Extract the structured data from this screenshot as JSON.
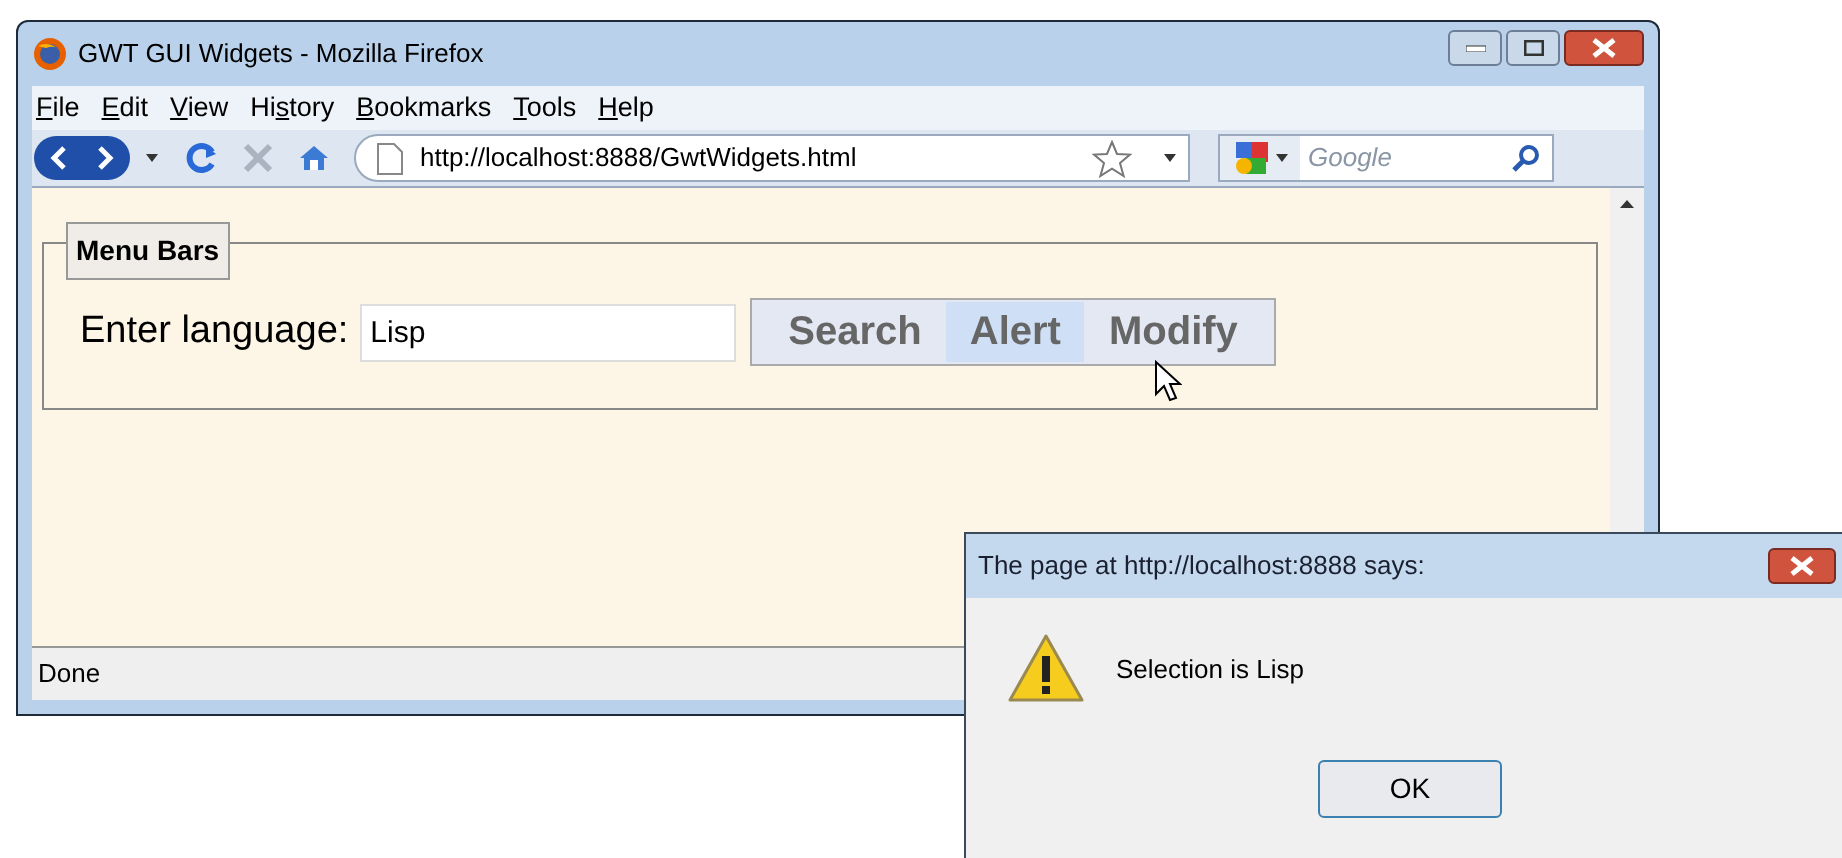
{
  "browser": {
    "title": "GWT GUI Widgets - Mozilla Firefox",
    "menu": [
      {
        "key": "F",
        "after": "ile"
      },
      {
        "key": "E",
        "after": "dit"
      },
      {
        "key": "V",
        "after": "iew"
      },
      {
        "before": "Hi",
        "key": "s",
        "after": "tory"
      },
      {
        "key": "B",
        "after": "ookmarks"
      },
      {
        "key": "T",
        "after": "ools"
      },
      {
        "key": "H",
        "after": "elp"
      }
    ],
    "url": "http://localhost:8888/GwtWidgets.html",
    "search_placeholder": "Google",
    "status": "Done"
  },
  "page": {
    "legend": "Menu Bars",
    "label": "Enter language:",
    "input_value": "Lisp",
    "menu_items": [
      {
        "label": "Search",
        "hovered": false
      },
      {
        "label": "Alert",
        "hovered": true
      },
      {
        "label": "Modify",
        "hovered": false
      }
    ]
  },
  "dialog": {
    "title": "The page at http://localhost:8888 says:",
    "message": "Selection is Lisp",
    "button": "OK"
  }
}
